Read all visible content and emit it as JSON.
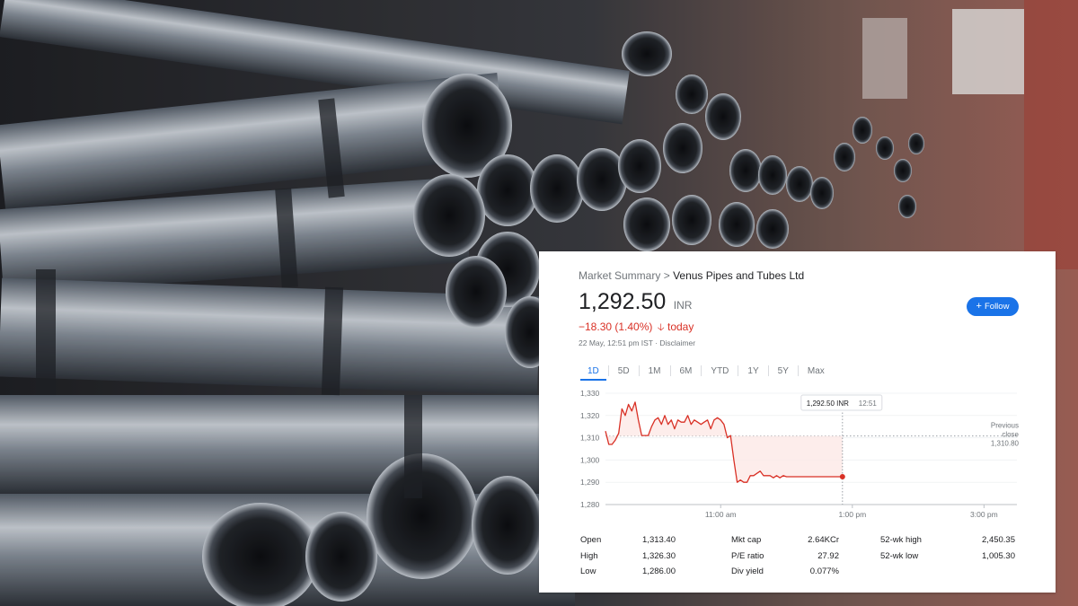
{
  "breadcrumb": {
    "prefix": "Market Summary",
    "separator": ">",
    "company": "Venus Pipes and Tubes Ltd"
  },
  "quote": {
    "price": "1,292.50",
    "currency": "INR",
    "change": "−18.30 (1.40%)",
    "change_suffix": "today",
    "direction": "down",
    "timestamp": "22 May, 12:51 pm IST · Disclaimer"
  },
  "follow_button": {
    "label": "Follow",
    "icon": "plus-icon"
  },
  "tabs": [
    "1D",
    "5D",
    "1M",
    "6M",
    "YTD",
    "1Y",
    "5Y",
    "Max"
  ],
  "active_tab": "1D",
  "colors": {
    "down": "#d93025",
    "accent": "#1a73e8",
    "fill": "#fce8e6"
  },
  "chart_data": {
    "type": "line",
    "ylim": [
      1280,
      1330
    ],
    "yticks": [
      "1,330",
      "1,320",
      "1,310",
      "1,300",
      "1,290",
      "1,280"
    ],
    "ytick_values": [
      1330,
      1320,
      1310,
      1300,
      1290,
      1280
    ],
    "xticks": [
      "11:00 am",
      "1:00 pm",
      "3:00 pm"
    ],
    "xtick_times": [
      "11:00",
      "13:00",
      "15:00"
    ],
    "session": [
      "09:15",
      "15:30"
    ],
    "previous_close": 1310.8,
    "previous_close_label": [
      "Previous",
      "close",
      "1,310.80"
    ],
    "tooltip": {
      "price": "1,292.50 INR",
      "time": "12:51"
    },
    "series": [
      {
        "x": [
          "09:15",
          "09:18",
          "09:21",
          "09:24",
          "09:27",
          "09:30",
          "09:33",
          "09:36",
          "09:39",
          "09:42",
          "09:45",
          "09:48",
          "09:51",
          "09:54",
          "09:57",
          "10:00",
          "10:03",
          "10:06",
          "10:09",
          "10:12",
          "10:15",
          "10:18",
          "10:21",
          "10:24",
          "10:27",
          "10:30",
          "10:33",
          "10:36",
          "10:39",
          "10:42",
          "10:45",
          "10:48",
          "10:51",
          "10:54",
          "10:57",
          "11:00",
          "11:03",
          "11:06",
          "11:09",
          "11:12",
          "11:15",
          "11:18",
          "11:21",
          "11:24",
          "11:27",
          "11:30",
          "11:33",
          "11:36",
          "11:39",
          "11:42",
          "11:45",
          "11:48",
          "11:51",
          "11:54",
          "11:57",
          "12:00",
          "12:03",
          "12:06",
          "12:09",
          "12:12",
          "12:15",
          "12:18",
          "12:21",
          "12:24",
          "12:27",
          "12:30",
          "12:33",
          "12:36",
          "12:39",
          "12:42",
          "12:45",
          "12:48",
          "12:51"
        ],
        "y": [
          1313,
          1307,
          1307,
          1309,
          1312,
          1323,
          1320,
          1325,
          1322,
          1326,
          1318,
          1311,
          1311,
          1311,
          1315,
          1318,
          1319,
          1316,
          1320,
          1316,
          1318,
          1314,
          1318,
          1317,
          1317,
          1320,
          1316,
          1318,
          1317,
          1316,
          1317,
          1318,
          1314,
          1318,
          1319,
          1318,
          1316,
          1310,
          1311,
          1300,
          1290,
          1291,
          1290,
          1290,
          1293,
          1293,
          1294,
          1295,
          1293,
          1293,
          1293,
          1292,
          1293,
          1292,
          1293,
          1292.5,
          1292.5,
          1292.5,
          1292.5,
          1292.5,
          1292.5,
          1292.5,
          1292.5,
          1292.5,
          1292.5,
          1292.5,
          1292.5,
          1292.5,
          1292.5,
          1292.5,
          1292.5,
          1292.5,
          1292.5
        ]
      }
    ]
  },
  "stats": [
    {
      "label": "Open",
      "value": "1,313.40"
    },
    {
      "label": "High",
      "value": "1,326.30"
    },
    {
      "label": "Low",
      "value": "1,286.00"
    },
    {
      "label": "Mkt cap",
      "value": "2.64KCr"
    },
    {
      "label": "P/E ratio",
      "value": "27.92"
    },
    {
      "label": "Div yield",
      "value": "0.077%"
    },
    {
      "label": "52-wk high",
      "value": "2,450.35"
    },
    {
      "label": "52-wk low",
      "value": "1,005.30"
    }
  ]
}
